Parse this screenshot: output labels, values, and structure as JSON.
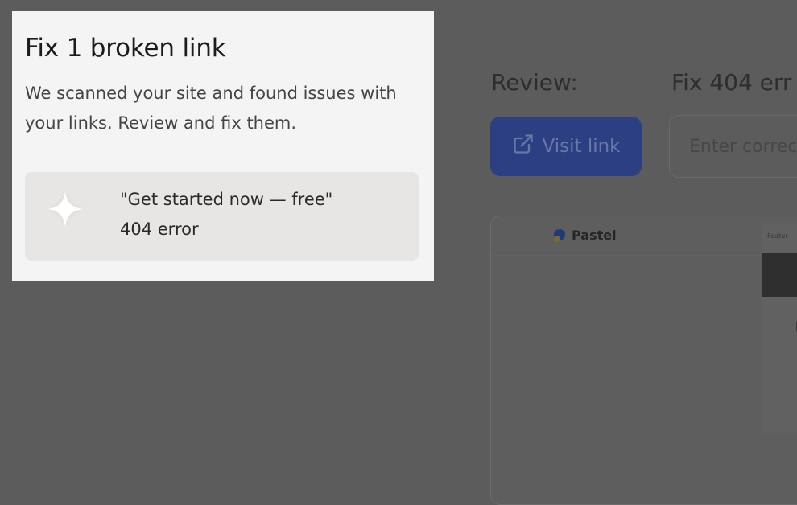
{
  "background": {
    "review_label": "Review:",
    "fix_label": "Fix 404 err",
    "visit_button_label": "Visit link",
    "url_input_placeholder": "Enter correct",
    "preview": {
      "brand_name": "Pastel",
      "side_card_label": "Featur"
    }
  },
  "popover": {
    "title": "Fix 1 broken link",
    "description": "We scanned your site and found issues with your links. Review and fix them.",
    "issue": {
      "link_text": "\"Get started now — free\"",
      "status": "404 error",
      "icon": "sparkle-icon"
    }
  },
  "colors": {
    "overlay": "#5c5c5c",
    "popover_bg": "#f4f4f4",
    "card_bg": "#e7e6e4",
    "primary_button": "#2b3f82"
  }
}
